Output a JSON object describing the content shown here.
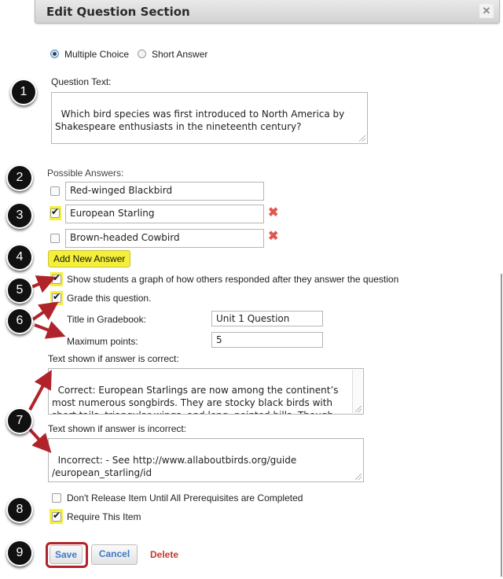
{
  "dialog": {
    "title": "Edit Question Section",
    "close_icon": "close-icon"
  },
  "question_type": {
    "options": [
      {
        "label": "Multiple Choice",
        "selected": true
      },
      {
        "label": "Short Answer",
        "selected": false
      }
    ]
  },
  "question_text": {
    "label": "Question Text:",
    "value": "Which bird species was first introduced to North America by Shakespeare enthusiasts in the nineteenth century?"
  },
  "answers": {
    "label": "Possible Answers:",
    "items": [
      {
        "text": "Red-winged Blackbird",
        "correct": false,
        "removable": false
      },
      {
        "text": "European Starling",
        "correct": true,
        "removable": true
      },
      {
        "text": "Brown-headed Cowbird",
        "correct": false,
        "removable": true
      }
    ],
    "add_label": "Add New Answer"
  },
  "options": {
    "show_graph": {
      "label": "Show students a graph of how others responded after they answer the question",
      "checked": true
    },
    "grade": {
      "label": "Grade this question.",
      "checked": true
    },
    "gradebook_title": {
      "label": "Title in Gradebook:",
      "value": "Unit 1 Question"
    },
    "max_points": {
      "label": "Maximum points:",
      "value": "5"
    }
  },
  "feedback": {
    "correct_label": "Text shown if answer is correct:",
    "correct_value": "Correct: European Starlings are now among the continent’s most numerous songbirds. They are stocky black birds with short tails, triangular wings, and long, pointed bills. Though they’re sometimes resented for their abundance and",
    "incorrect_label": "Text shown if answer is incorrect:",
    "incorrect_value": "Incorrect: - See http://www.allaboutbirds.org/guide\n/european_starling/id"
  },
  "release": {
    "prereq": {
      "label": "Don't Release Item Until All Prerequisites are Completed",
      "checked": false
    },
    "require": {
      "label": "Require This Item",
      "checked": true
    }
  },
  "actions": {
    "save": "Save",
    "cancel": "Cancel",
    "delete": "Delete"
  },
  "callouts": [
    "1",
    "2",
    "3",
    "4",
    "5",
    "6",
    "7",
    "8",
    "9"
  ],
  "colors": {
    "highlight": "#f4f03a",
    "arrow": "#b0232b",
    "link_blue": "#3d78c5",
    "delete_red": "#c0392b"
  }
}
